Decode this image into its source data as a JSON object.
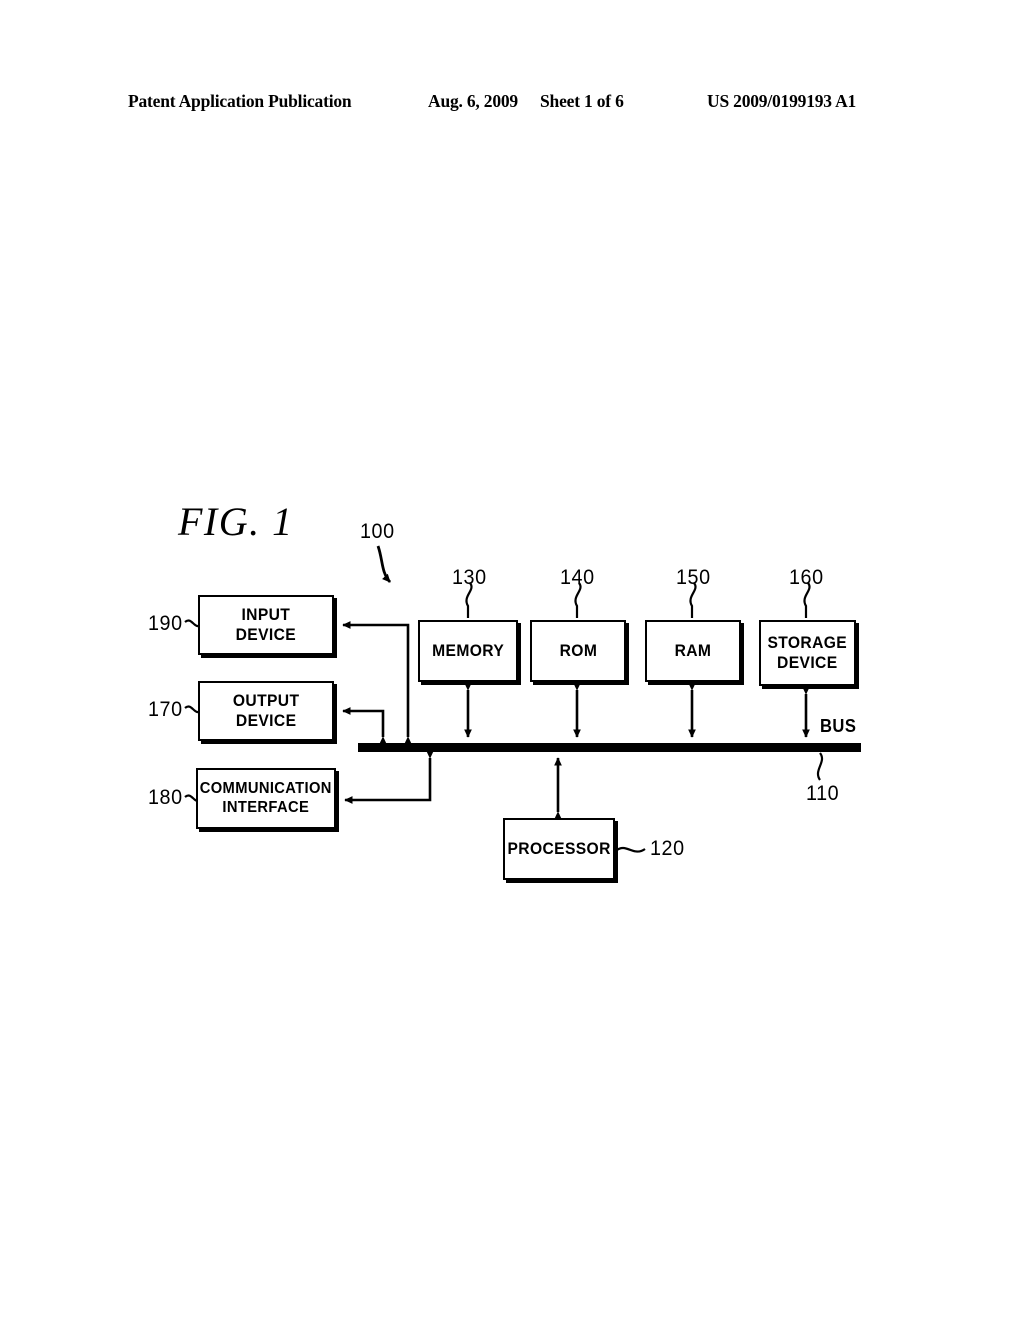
{
  "header": {
    "publication": "Patent Application Publication",
    "date": "Aug. 6, 2009",
    "sheet": "Sheet 1 of 6",
    "document_id": "US 2009/0199193 A1"
  },
  "figure": {
    "title": "FIG. 1",
    "system_ref": "100",
    "bus": {
      "label": "BUS",
      "ref": "110"
    },
    "boxes": [
      {
        "id": "input",
        "label": "INPUT\nDEVICE",
        "ref": "190"
      },
      {
        "id": "output",
        "label": "OUTPUT\nDEVICE",
        "ref": "170"
      },
      {
        "id": "comm",
        "label": "COMMUNICATION\nINTERFACE",
        "ref": "180"
      },
      {
        "id": "memory",
        "label": "MEMORY",
        "ref": "130"
      },
      {
        "id": "rom",
        "label": "ROM",
        "ref": "140"
      },
      {
        "id": "ram",
        "label": "RAM",
        "ref": "150"
      },
      {
        "id": "storage",
        "label": "STORAGE\nDEVICE",
        "ref": "160"
      },
      {
        "id": "processor",
        "label": "PROCESSOR",
        "ref": "120"
      }
    ]
  },
  "colors": {
    "ink": "#000000",
    "paper": "#ffffff"
  }
}
